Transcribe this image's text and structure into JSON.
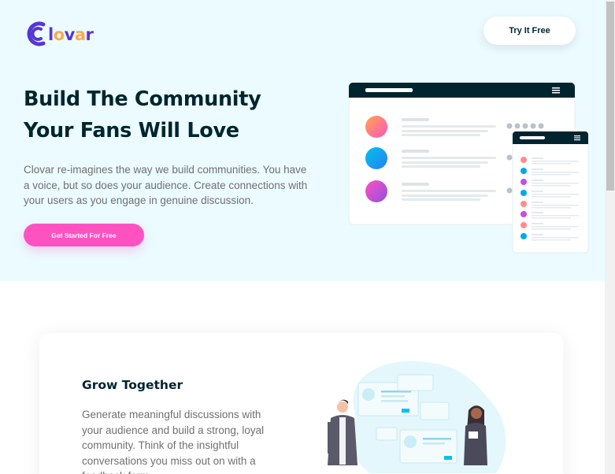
{
  "header": {
    "logo_text": "Clovar",
    "cta_label": "Try It Free"
  },
  "hero": {
    "title_line1": "Build The Community",
    "title_line2": "Your Fans Will Love",
    "description": "Clovar re-imagines the way we build communities. You have a voice, but so does your audience. Create connections with your users as you engage in genuine discussion.",
    "cta_label": "Get Started For Free"
  },
  "features": [
    {
      "title": "Grow Together",
      "description": "Generate meaningful discussions with your audience and build a strong, loyal community. Think of the insightful conversations you miss out on with a feedback form."
    }
  ],
  "colors": {
    "hero_bg": "#ebfbff",
    "heading": "#00252e",
    "body_text": "#707070",
    "accent_pink": "#ff52c1",
    "logo_purple": "#5636d3",
    "logo_orange": "#ffa84c",
    "mock_header": "#00252e"
  }
}
